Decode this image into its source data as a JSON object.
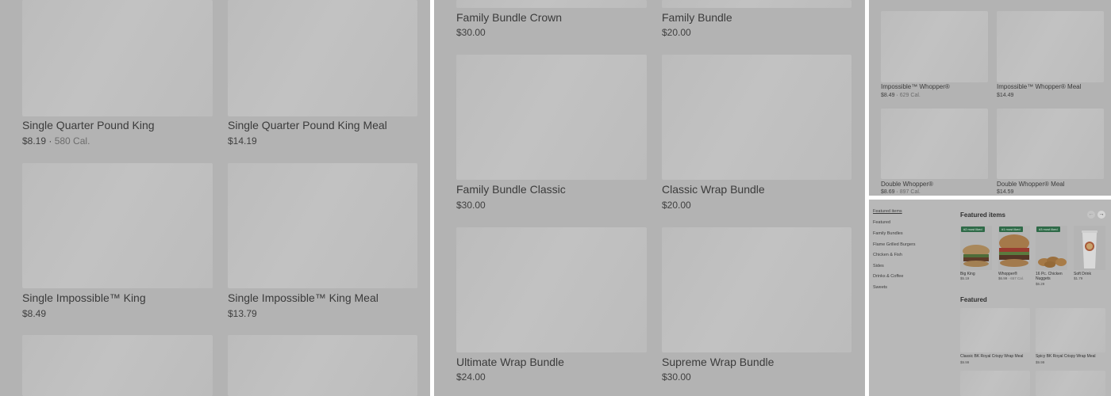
{
  "panel1": {
    "items": [
      {
        "name": "Single Quarter Pound King",
        "price": "$8.19",
        "cal": "580 Cal."
      },
      {
        "name": "Single Quarter Pound King Meal",
        "price": "$14.19",
        "cal": ""
      },
      {
        "name": "Single Impossible™ King",
        "price": "$8.49",
        "cal": ""
      },
      {
        "name": "Single Impossible™ King Meal",
        "price": "$13.79",
        "cal": ""
      }
    ]
  },
  "panel2": {
    "items": [
      {
        "name": "Family Bundle Crown",
        "price": "$30.00"
      },
      {
        "name": "Family Bundle",
        "price": "$20.00"
      },
      {
        "name": "Family Bundle Classic",
        "price": "$30.00"
      },
      {
        "name": "Classic Wrap Bundle",
        "price": "$20.00"
      },
      {
        "name": "Ultimate Wrap Bundle",
        "price": "$24.00"
      },
      {
        "name": "Supreme Wrap Bundle",
        "price": "$30.00"
      }
    ]
  },
  "panel3": {
    "items": [
      {
        "name": "Impossible™ Whopper®",
        "price": "$8.49",
        "cal": "629 Cal."
      },
      {
        "name": "Impossible™ Whopper® Meal",
        "price": "$14.49",
        "cal": ""
      },
      {
        "name": "Double Whopper®",
        "price": "$8.69",
        "cal": "897 Cal."
      },
      {
        "name": "Double Whopper® Meal",
        "price": "$14.59",
        "cal": ""
      }
    ]
  },
  "panel4": {
    "nav": [
      "Featured items",
      "Featured",
      "Family Bundles",
      "Flame Grilled Burgers",
      "Chicken & Fish",
      "Sides",
      "Drinks & Coffee",
      "Sweets"
    ],
    "featured_items_title": "Featured items",
    "featured_title": "Featured",
    "arrows": {
      "prev": "←",
      "next": "→"
    },
    "featured_items": [
      {
        "badge": "#2 most liked",
        "name": "Big King",
        "price": "$5.19",
        "cal": ""
      },
      {
        "badge": "#1 most liked",
        "name": "Whopper®",
        "price": "$6.99",
        "cal": "657 Cal."
      },
      {
        "badge": "#3 most liked",
        "name": "16 Pc. Chicken Nuggets",
        "price": "$6.29",
        "cal": ""
      },
      {
        "badge": "",
        "name": "Soft Drink",
        "price": "$1.79",
        "cal": ""
      }
    ],
    "featured": [
      {
        "name": "Classic BK Royal Crispy Wrap Meal",
        "price": "$9.99"
      },
      {
        "name": "Spicy BK Royal Crispy Wrap  Meal",
        "price": "$9.99"
      }
    ]
  },
  "colors": {
    "overlay": "#b3b3b3",
    "tile": "#bebebe",
    "badge": "#2f6a48"
  }
}
